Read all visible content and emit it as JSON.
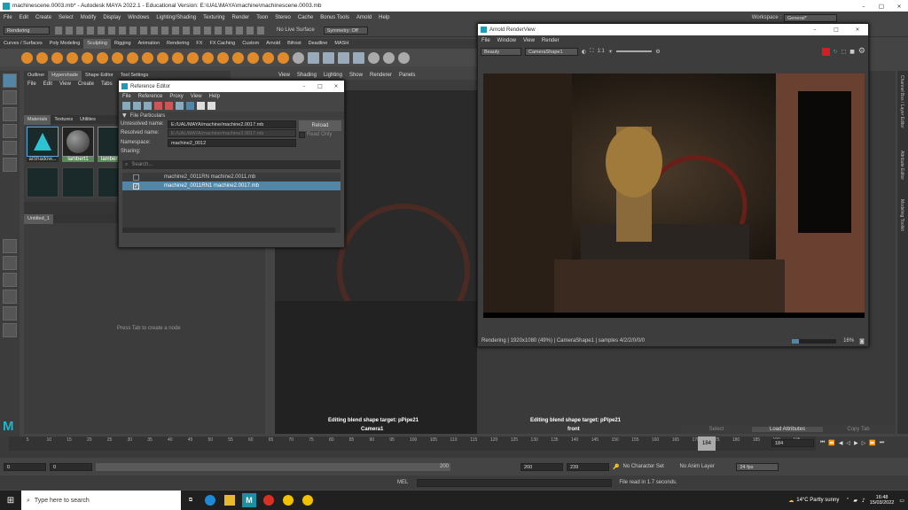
{
  "window": {
    "title": "machinescene.0003.mb* - Autodesk MAYA 2022.1 - Educational Version: E:\\UAL\\MAYA\\machine\\machinescene.0003.mb"
  },
  "menubar": {
    "items": [
      "File",
      "Edit",
      "Create",
      "Select",
      "Modify",
      "Display",
      "Windows",
      "Lighting/Shading",
      "Texturing",
      "Render",
      "Toon",
      "Stereo",
      "Cache",
      "Bonus Tools",
      "Arnold",
      "Help"
    ],
    "workspace_label": "Workspace :",
    "workspace_value": "General*"
  },
  "statusline": {
    "menu_set": "Rendering",
    "live_surface": "No Live Surface",
    "symmetry": "Symmetry: Off"
  },
  "shelf": {
    "tabs": [
      "Curves / Surfaces",
      "Poly Modeling",
      "Sculpting",
      "Rigging",
      "Animation",
      "Rendering",
      "FX",
      "FX Caching",
      "Custom",
      "Arnold",
      "Bifrost",
      "Deadline",
      "MASH"
    ]
  },
  "hypershade": {
    "tabs": [
      "Outliner",
      "Hypershade",
      "Shape Editor",
      "Tool Settings"
    ],
    "menus": [
      "File",
      "Edit",
      "View",
      "Create",
      "Tabs"
    ],
    "subtabs": [
      "Materials",
      "Textures",
      "Utilities"
    ],
    "swatches": [
      "aiShadow...",
      "lambert1",
      "lambert"
    ],
    "graph_tab": "Untitled_1",
    "graph_hint": "Press Tab to create a node"
  },
  "viewport": {
    "menus": [
      "View",
      "Shading",
      "Lighting",
      "Show",
      "Renderer",
      "Panels"
    ],
    "hud": "Editing blend shape target: pPipe21",
    "camera": "Camera1",
    "camera2": "front"
  },
  "ref_editor": {
    "title": "Reference Editor",
    "menus": [
      "File",
      "Reference",
      "Proxy",
      "View",
      "Help"
    ],
    "section": "File Particulars",
    "unresolved_label": "Unresolved name:",
    "unresolved_value": "E:/UAL/MAYA/machine/machine2.0017.mb",
    "resolved_label": "Resolved name:",
    "resolved_value": "E:/UAL/MAYA/machine/machine2.0017.mb",
    "namespace_label": "Namespace:",
    "namespace_value": "machine2_0012",
    "sharing_label": "Sharing:",
    "reload": "Reload",
    "read_only": "Read Only",
    "search_placeholder": "Search...",
    "rows": [
      "machine2_0011RN machine2.0011.mb",
      "machine2_0011RN1 machine2.0017.mb"
    ]
  },
  "arnold": {
    "title": "Arnold RenderView",
    "menus": [
      "File",
      "Window",
      "View",
      "Render"
    ],
    "aov": "Beauty",
    "camera": "CameraShape1",
    "ratio": "1:1",
    "status": "Rendering | 1920x1080 (49%) | CameraShape1 | samples 4/2/2/0/0/0",
    "zoom": "16%"
  },
  "attr": {
    "buttons": [
      "Select",
      "Load Attributes",
      "Copy Tab"
    ],
    "side_labels": [
      "Channel Box / Layer Editor",
      "Attribute Editor",
      "Modeling Toolkit"
    ]
  },
  "timeline": {
    "ticks": [
      "5",
      "10",
      "15",
      "20",
      "25",
      "30",
      "35",
      "40",
      "45",
      "50",
      "55",
      "60",
      "65",
      "70",
      "75",
      "80",
      "85",
      "90",
      "95",
      "100",
      "105",
      "110",
      "115",
      "120",
      "125",
      "130",
      "135",
      "140",
      "145",
      "150",
      "155",
      "160",
      "165",
      "170",
      "175",
      "180",
      "185",
      "190",
      "195"
    ],
    "current": "184",
    "current_field": "184"
  },
  "range": {
    "start": "0",
    "start2": "0",
    "slider_end": "200",
    "end": "200",
    "end2": "239",
    "character_set": "No Character Set",
    "anim_layer": "No Anim Layer",
    "fps": "24 fps"
  },
  "cmdline": {
    "lang": "MEL",
    "message": "File read in  1.7 seconds."
  },
  "taskbar": {
    "search": "Type here to search",
    "weather": "14°C  Partly sunny",
    "time": "16:48",
    "date": "15/03/2022"
  },
  "colors": {
    "accent": "#5285a6",
    "shelf_icon": "#e08a2a",
    "selected_row": "#5285a6"
  }
}
